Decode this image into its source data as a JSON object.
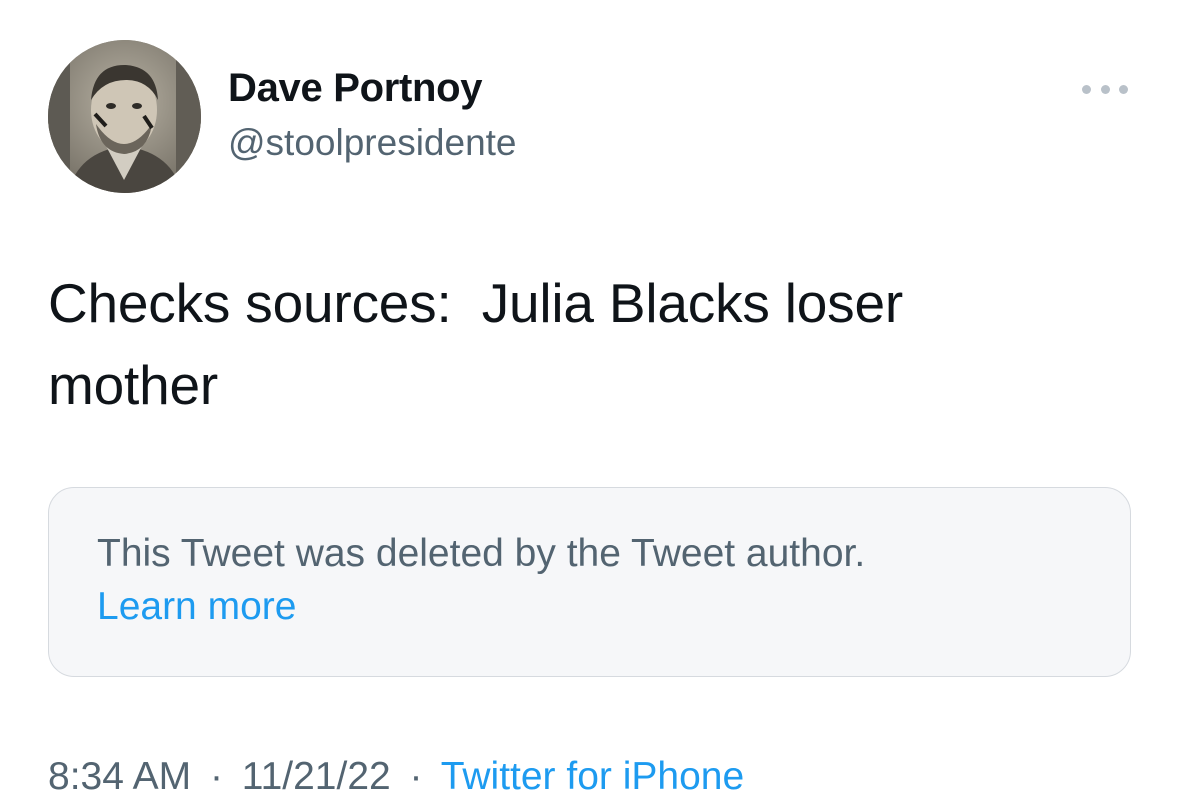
{
  "author": {
    "name": "Dave Portnoy",
    "handle": "@stoolpresidente"
  },
  "tweet": {
    "text": "Checks sources:  Julia Blacks loser\nmother"
  },
  "deleted_quote": {
    "message": "This Tweet was deleted by the Tweet author.",
    "learn_more": "Learn more"
  },
  "meta": {
    "time": "8:34 AM",
    "separator": "·",
    "date": "11/21/22",
    "source": "Twitter for iPhone"
  },
  "icons": {
    "more": "more-horizontal-icon"
  },
  "colors": {
    "text_primary": "#0f1419",
    "text_secondary": "#536471",
    "link": "#1d9bf0",
    "box_bg": "#f6f7f9",
    "box_border": "#d6dadf"
  }
}
